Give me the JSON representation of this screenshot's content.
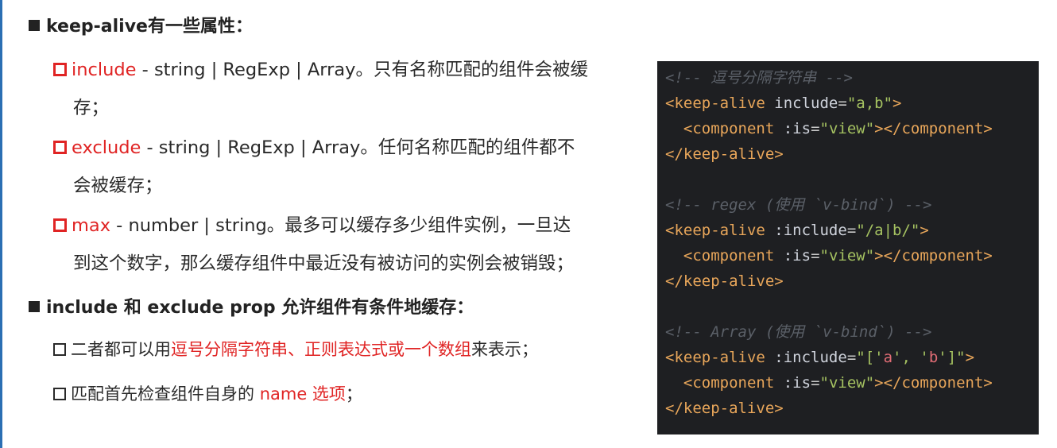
{
  "heading1": "keep-alive有一些属性：",
  "items": [
    {
      "name": "include",
      "rest": " - string | RegExp | Array。只有名称匹配的组件会被缓",
      "cont": "存；"
    },
    {
      "name": "exclude",
      "rest": " - string | RegExp | Array。任何名称匹配的组件都不",
      "cont": "会被缓存；"
    },
    {
      "name": "max",
      "rest": " - number | string。最多可以缓存多少组件实例，一旦达",
      "cont": "到这个数字，那么缓存组件中最近没有被访问的实例会被销毁；"
    }
  ],
  "heading2": "include 和 exclude prop 允许组件有条件地缓存：",
  "sub1": {
    "pre": "二者都可以用",
    "red": "逗号分隔字符串、正则表达式或一个数组",
    "post": "来表示；"
  },
  "sub2": {
    "pre": "匹配首先检查组件自身的 ",
    "red": "name 选项",
    "post": "；"
  },
  "code": {
    "c1": "<!-- 逗号分隔字符串 -->",
    "c2": "<!-- regex (使用 `v-bind`) -->",
    "c3": "<!-- Array (使用 `v-bind`) -->",
    "inc1": "\"a,b\"",
    "inc2": "\"/a|b/\"",
    "inc3a": "\"['",
    "inc3b": "a",
    "inc3c": "', '",
    "inc3d": "b",
    "inc3e": "']\"",
    "view": "\"view\""
  },
  "colors": {
    "accent": "#e02424",
    "code_bg": "#1e1f22"
  }
}
